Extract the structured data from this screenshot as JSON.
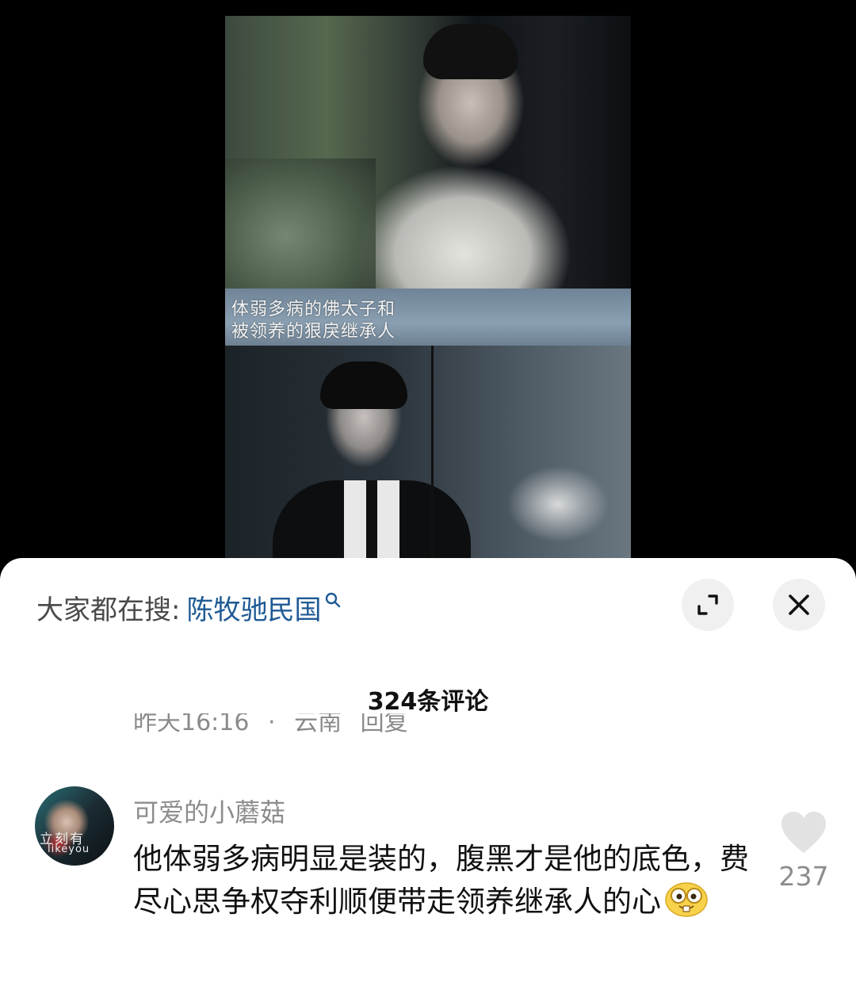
{
  "video": {
    "caption_line1": "体弱多病的佛太子和",
    "caption_line2": "被领养的狠戾继承人"
  },
  "search": {
    "prefix": "大家都在搜:",
    "term": "陈牧驰民国",
    "icon": "search-icon"
  },
  "toolbar": {
    "expand_icon": "expand-icon",
    "close_icon": "close-icon"
  },
  "comments": {
    "count_label": "324条评论",
    "prev_meta": "昨天16:16 · 云南 回复",
    "items": [
      {
        "avatar_text": "立刻有",
        "avatar_text2": "likeyou",
        "username": "可爱的小蘑菇",
        "text": "他体弱多病明显是装的，腹黑才是他的底色，费尽心思争权夺利顺便带走领养继承人的心",
        "emoji": "nerd-face-emoji",
        "likes": "237",
        "like_icon": "heart-icon"
      }
    ]
  },
  "colors": {
    "link": "#1f5a94",
    "muted": "#8c8c8c",
    "button_bg": "#f0f0f0",
    "heart": "#e2e2e2"
  }
}
